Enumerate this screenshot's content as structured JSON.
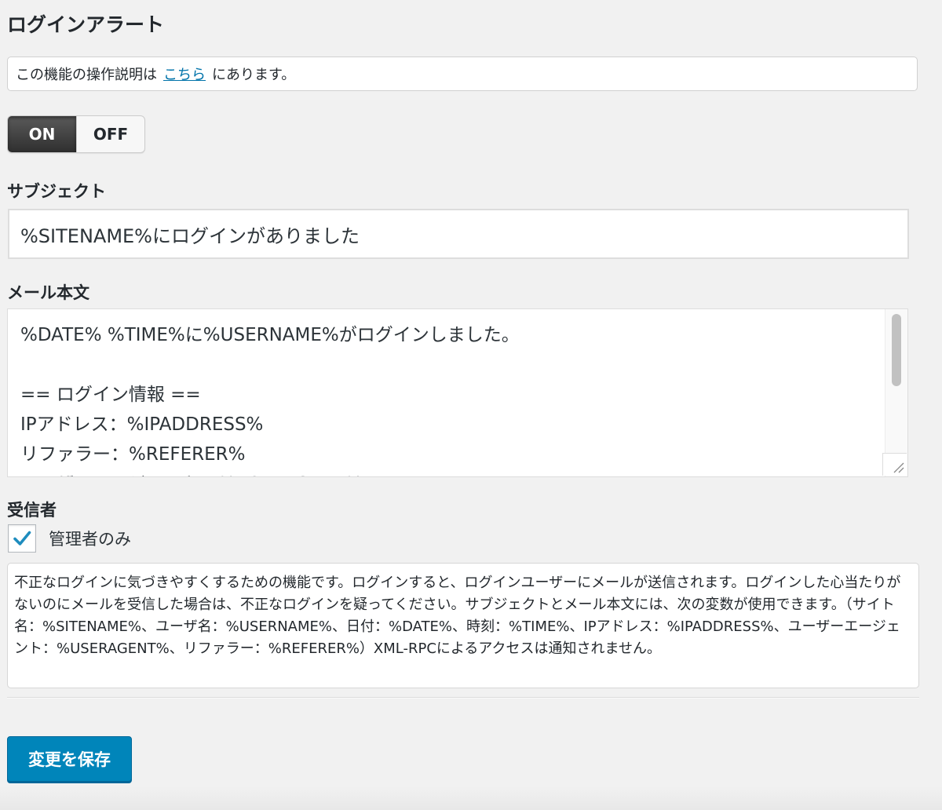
{
  "page": {
    "title": "ログインアラート"
  },
  "notice": {
    "before": "この機能の操作説明は",
    "link": "こちら",
    "after": "にあります。"
  },
  "toggle": {
    "on_label": "ON",
    "off_label": "OFF",
    "selected": "ON"
  },
  "subject": {
    "label": "サブジェクト",
    "value": "%SITENAME%にログインがありました"
  },
  "mail_body": {
    "label": "メール本文",
    "lines": [
      "%DATE% %TIME%に%USERNAME%がログインしました。",
      "",
      "== ログイン情報 ==",
      "IPアドレス：%IPADDRESS%",
      "リファラー：%REFERER%",
      "ユーザーエージェント：%USERAGENT%"
    ]
  },
  "recipient": {
    "label": "受信者",
    "option_label": "管理者のみ",
    "checked": true
  },
  "description": {
    "text": "不正なログインに気づきやすくするための機能です。ログインすると、ログインユーザーにメールが送信されます。ログインした心当たりがないのにメールを受信した場合は、不正なログインを疑ってください。サブジェクトとメール本文には、次の変数が使用できます。（サイト名：%SITENAME%、ユーザ名：%USERNAME%、日付：%DATE%、時刻：%TIME%、IPアドレス：%IPADDRESS%、ユーザーエージェント：%USERAGENT%、リファラー：%REFERER%）XML-RPCによるアクセスは通知されません。"
  },
  "actions": {
    "save_label": "変更を保存"
  },
  "colors": {
    "link": "#0073aa",
    "primary_button": "#0085ba",
    "check_mark": "#1e8cbe",
    "toggle_on": "#3a3a3a"
  },
  "icons": {
    "check": "check-icon",
    "resize": "resize-grip-icon"
  }
}
